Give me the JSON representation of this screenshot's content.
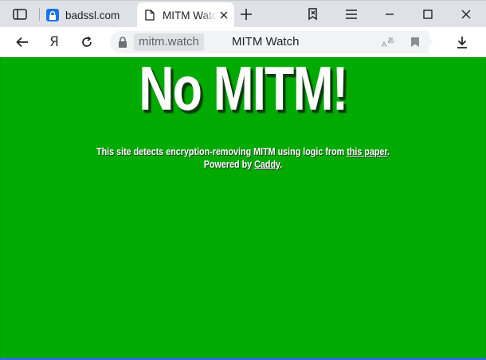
{
  "tabs": [
    {
      "title": "badssl.com",
      "favicon": "lock-favicon-icon",
      "state": "inactive"
    },
    {
      "title": "MITM Watch",
      "favicon": "page-icon",
      "state": "active"
    }
  ],
  "toolbar": {
    "domain": "mitm.watch",
    "page_title": "MITM Watch"
  },
  "page": {
    "headline": "No MITM!",
    "line1_prefix": "This site detects encryption-removing MITM using logic from ",
    "line1_link": "this paper",
    "line1_suffix": ".",
    "line2_prefix": "Powered by ",
    "line2_link": "Caddy",
    "line2_suffix": "."
  },
  "colors": {
    "page_background": "#00aa00",
    "tab_strip": "#dee1e6",
    "favicon_accent": "#1a73e8"
  }
}
